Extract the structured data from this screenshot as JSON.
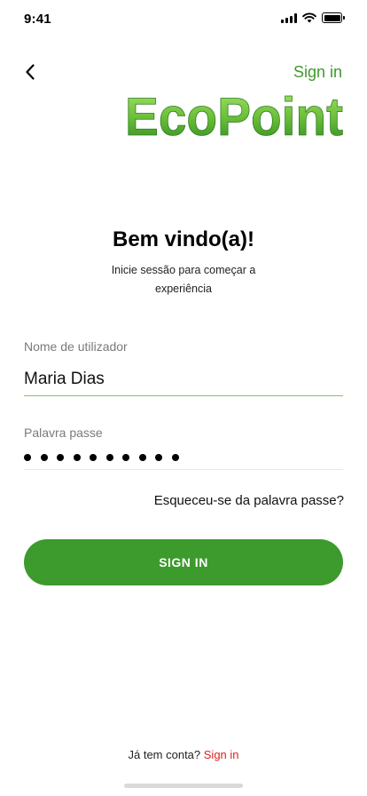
{
  "status_bar": {
    "time": "9:41"
  },
  "header": {
    "signin_label": "Sign in"
  },
  "logo": {
    "text": "EcoPoint",
    "color_top": "#8bd14a",
    "color_bottom": "#2f8a1f"
  },
  "welcome": {
    "title": "Bem vindo(a)!",
    "subtitle": "Inicie sessão para começar a experiência"
  },
  "form": {
    "username": {
      "label": "Nome de utilizador",
      "value": "Maria Dias"
    },
    "password": {
      "label": "Palavra passe",
      "masked_length": 10
    },
    "forgot_label": "Esqueceu-se da palavra passe?",
    "submit_label": "SIGN IN"
  },
  "footer": {
    "prompt": "Já tem conta?",
    "link_label": "Sign in"
  },
  "colors": {
    "accent": "#3d9a2d",
    "link_red": "#e02020",
    "active_underline": "#7cc86a"
  }
}
